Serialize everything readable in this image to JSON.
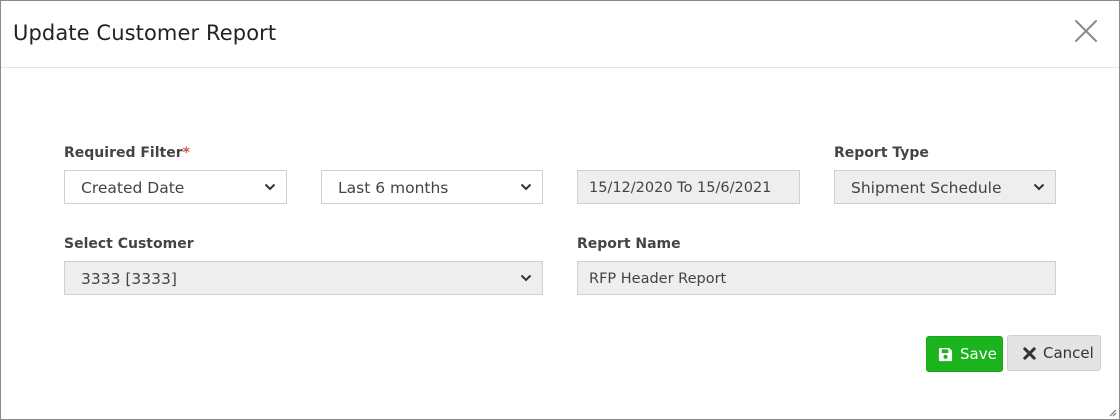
{
  "dialog": {
    "title": "Update Customer Report"
  },
  "filters": {
    "required_filter_label": "Required Filter",
    "required_marker": "*",
    "date_field_value": "Created Date",
    "period_value": "Last 6 months",
    "date_range_value": "15/12/2020 To 15/6/2021",
    "report_type_label": "Report Type",
    "report_type_value": "Shipment Schedule",
    "select_customer_label": "Select Customer",
    "customer_value": "3333 [3333]",
    "report_name_label": "Report Name",
    "report_name_value": "RFP Header Report"
  },
  "actions": {
    "save_label": "Save",
    "cancel_label": "Cancel"
  },
  "icons": {
    "close": "close-icon",
    "save": "floppy-disk-icon",
    "cancel": "x-icon",
    "dropdown": "chevron-down-icon",
    "resize": "resize-grip-icon"
  },
  "colors": {
    "save_button": "#1cb41c",
    "required_marker": "#d9534f",
    "readonly_field": "#eeeeee"
  }
}
